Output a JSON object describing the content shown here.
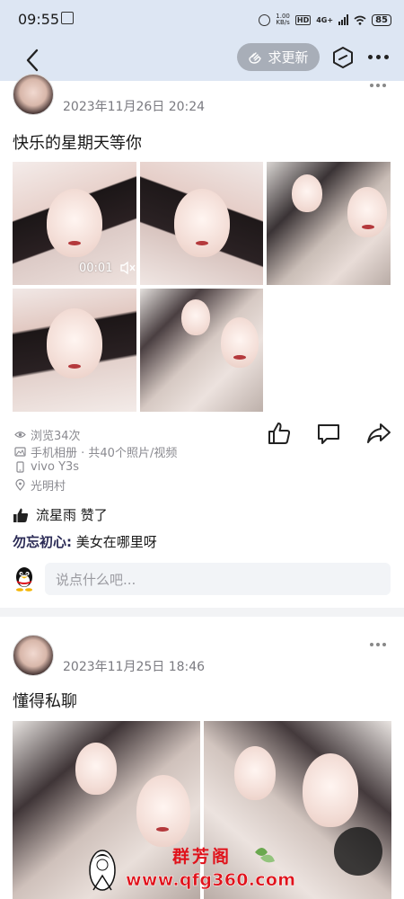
{
  "status_bar": {
    "time": "09:55",
    "speed_top": "1.00",
    "speed_bottom": "KB/s",
    "hd": "HD",
    "network": "4G+",
    "battery": "85"
  },
  "nav": {
    "update_label": "求更新"
  },
  "posts": [
    {
      "name": "",
      "time": "2023年11月26日 20:24",
      "text": "快乐的星期天等你",
      "video_duration": "00:01",
      "views": "浏览34次",
      "source": "手机相册 · 共40个照片/视频",
      "device": "vivo Y3s",
      "location": "光明村",
      "likes": "流星雨 赞了",
      "comment_author": "勿忘初心:",
      "comment_text": " 美女在哪里呀",
      "comment_placeholder": "说点什么吧..."
    },
    {
      "name": "",
      "time": "2023年11月25日 18:46",
      "text": "懂得私聊"
    }
  ],
  "watermark": {
    "brand": "群芳阁",
    "url": "www.qfg360.com"
  },
  "colors": {
    "nav_bg": "#dde6f3",
    "watermark_red": "#e0121b",
    "meta_gray": "#8a8a90"
  }
}
